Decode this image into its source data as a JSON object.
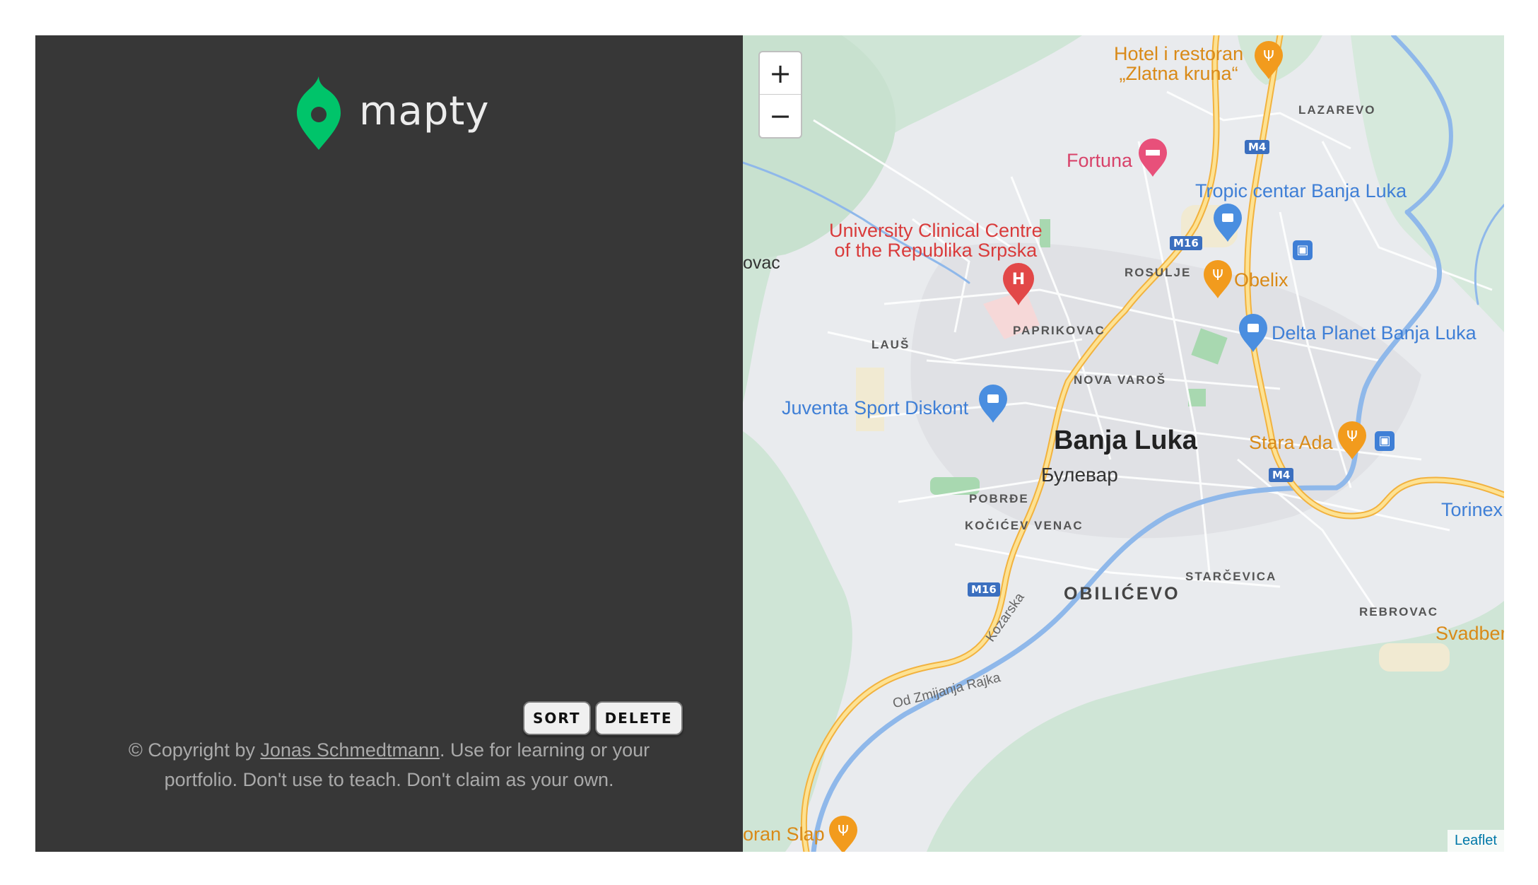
{
  "sidebar": {
    "logo_text": "mapty",
    "buttons": {
      "sort": "SORT",
      "delete": "DELETE"
    },
    "copyright": {
      "prefix": "© Copyright by ",
      "author": "Jonas Schmedtmann",
      "line1_suffix": ". Use for learning or your",
      "line2": "portfolio. Don't use to teach. Don't claim as your own."
    }
  },
  "map": {
    "zoom_in": "+",
    "zoom_out": "−",
    "attribution": "Leaflet",
    "labels": {
      "hotel": "Hotel i restoran",
      "hotel2": "„Zlatna kruna“",
      "lazarevo": "LAZAREVO",
      "fortuna": "Fortuna",
      "tropic": "Tropic centar Banja Luka",
      "ucc1": "University Clinical Centre",
      "ucc2": "of the Republika Srpska",
      "ovac": "ovac",
      "rosulje": "ROSULJE",
      "obelix": "Obelix",
      "paprikovac": "PAPRIKOVAC",
      "laus": "LAUŠ",
      "delta": "Delta Planet Banja Luka",
      "nova_varos": "NOVA VAROŠ",
      "juventa": "Juventa Sport Diskont",
      "banja_luka": "Banja Luka",
      "bulevar": "Булевар",
      "stara_ada": "Stara Ada",
      "pobrde": "POBRĐE",
      "torinex": "Torinex",
      "kocicev": "KOČIĆEV VENAC",
      "starcevica": "STARČEVICA",
      "obilicevo": "OBILIĆEVO",
      "rebrovac": "REBROVAC",
      "svadber": "Svadber",
      "kozarska": "Kozarska",
      "od_zmijanja": "Od Zmijanja Rajka",
      "oran_slap": "oran Slap"
    },
    "shields": {
      "m4a": "M4",
      "m16a": "M16",
      "m4b": "M4",
      "m16b": "M16"
    }
  }
}
